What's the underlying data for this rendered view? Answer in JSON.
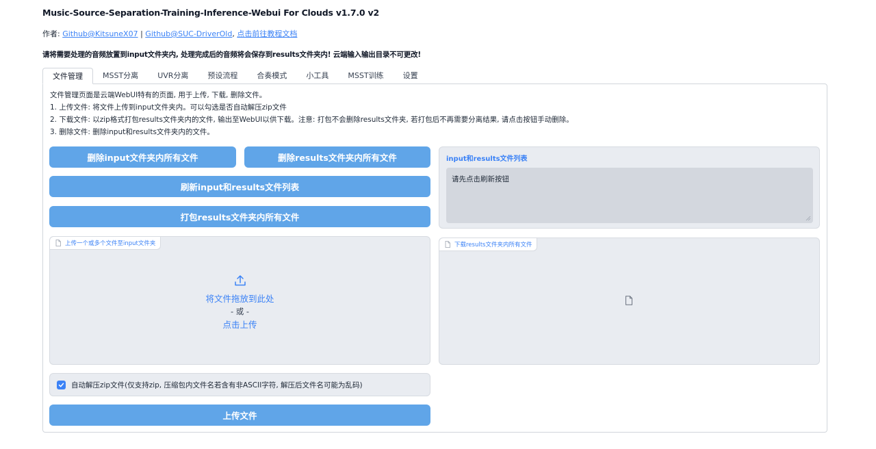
{
  "header": {
    "title": "Music-Source-Separation-Training-Inference-Webui For Clouds v1.7.0 v2",
    "author_prefix": "作者: ",
    "author_link_1": "Github@KitsuneX07",
    "separator": " | ",
    "author_link_2": "Github@SUC-DriverOld",
    "comma": ", ",
    "tutorial_link": "点击前往教程文档",
    "notice": "请将需要处理的音频放置到input文件夹内, 处理完成后的音频将会保存到results文件夹内! 云端输入输出目录不可更改!"
  },
  "tabs": [
    {
      "label": "文件管理",
      "active": true
    },
    {
      "label": "MSST分离",
      "active": false
    },
    {
      "label": "UVR分离",
      "active": false
    },
    {
      "label": "预设流程",
      "active": false
    },
    {
      "label": "合奏模式",
      "active": false
    },
    {
      "label": "小工具",
      "active": false
    },
    {
      "label": "MSST训练",
      "active": false
    },
    {
      "label": "设置",
      "active": false
    }
  ],
  "description": [
    "文件管理页面是云端WebUI特有的页面, 用于上传, 下载, 删除文件。",
    "1. 上传文件: 将文件上传到input文件夹内。可以勾选是否自动解压zip文件",
    "2. 下载文件: 以zip格式打包results文件夹内的文件, 输出至WebUI以供下载。注意: 打包不会删除results文件夹, 若打包后不再需要分离结果, 请点击按钮手动删除。",
    "3. 删除文件: 删除input和results文件夹内的文件。"
  ],
  "buttons": {
    "delete_input": "删除input文件夹内所有文件",
    "delete_results": "删除results文件夹内所有文件",
    "refresh_list": "刷新input和results文件列表",
    "pack_results": "打包results文件夹内所有文件",
    "upload": "上传文件"
  },
  "file_list": {
    "label": "input和results文件列表",
    "value": "请先点击刷新按钮"
  },
  "upload_box": {
    "label": "上传一个或多个文件至input文件夹",
    "drop_text": "将文件拖放到此处",
    "or_text": "- 或 -",
    "click_text": "点击上传"
  },
  "download_box": {
    "label": "下载results文件夹内所有文件"
  },
  "auto_unzip": {
    "checked": true,
    "label": "自动解压zip文件(仅支持zip, 压缩包内文件名若含有非ASCII字符, 解压后文件名可能为乱码)"
  },
  "colors": {
    "accent": "#3b82f6",
    "button": "#60a5e8",
    "box_bg": "#e9ecf1"
  }
}
